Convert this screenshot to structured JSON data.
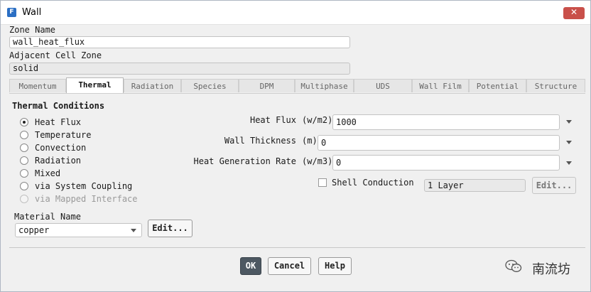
{
  "window": {
    "title": "Wall",
    "app_icon": "F",
    "close_glyph": "✕"
  },
  "zone_name": {
    "label": "Zone Name",
    "value": "wall_heat_flux"
  },
  "adjacent_cell_zone": {
    "label": "Adjacent Cell Zone",
    "value": "solid"
  },
  "tabs": [
    {
      "label": "Momentum"
    },
    {
      "label": "Thermal"
    },
    {
      "label": "Radiation"
    },
    {
      "label": "Species"
    },
    {
      "label": "DPM"
    },
    {
      "label": "Multiphase"
    },
    {
      "label": "UDS"
    },
    {
      "label": "Wall Film"
    },
    {
      "label": "Potential"
    },
    {
      "label": "Structure"
    }
  ],
  "active_tab": "Thermal",
  "thermal": {
    "section_title": "Thermal Conditions",
    "options": [
      {
        "label": "Heat Flux"
      },
      {
        "label": "Temperature"
      },
      {
        "label": "Convection"
      },
      {
        "label": "Radiation"
      },
      {
        "label": "Mixed"
      },
      {
        "label": "via System Coupling"
      },
      {
        "label": "via Mapped Interface"
      }
    ],
    "selected": "Heat Flux",
    "heat_flux": {
      "label": "Heat Flux",
      "unit": "(w/m2)",
      "value": "1000"
    },
    "wall_thickness": {
      "label": "Wall Thickness",
      "unit": "(m)",
      "value": "0"
    },
    "heat_generation_rate": {
      "label": "Heat Generation Rate",
      "unit": "(w/m3)",
      "value": "0"
    },
    "shell_conduction": {
      "label": "Shell Conduction",
      "checked": false,
      "layers": "1 Layer",
      "edit_label": "Edit..."
    },
    "material": {
      "label": "Material Name",
      "value": "copper",
      "edit_label": "Edit..."
    }
  },
  "footer": {
    "ok": "OK",
    "cancel": "Cancel",
    "help": "Help"
  },
  "watermark": {
    "text": "南流坊",
    "icon": "wechat-icon"
  }
}
